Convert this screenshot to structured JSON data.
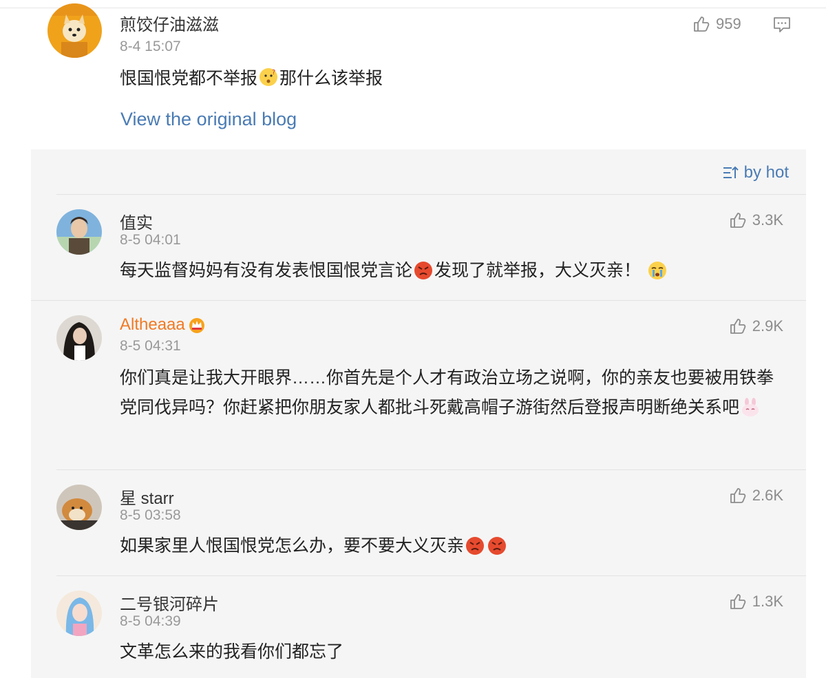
{
  "post": {
    "author": "煎饺仔油滋滋",
    "time": "8-4 15:07",
    "text_before": "恨国恨党都不举报",
    "text_after": "那什么该举报",
    "likes": "959",
    "view_original": "View the original blog"
  },
  "sort_label": "by hot",
  "comments": [
    {
      "author": "值实",
      "time": "8-5 04:01",
      "likes": "3.3K",
      "text_a": "每天监督妈妈有没有发表恨国恨党言论",
      "text_b": "发现了就举报，大义灭亲！"
    },
    {
      "author": "Altheaaa",
      "time": "8-5 04:31",
      "likes": "2.9K",
      "text": "你们真是让我大开眼界……你首先是个人才有政治立场之说啊，你的亲友也要被用铁拳党同伐异吗？你赶紧把你朋友家人都批斗死戴高帽子游街然后登报声明断绝关系吧"
    },
    {
      "author": "星 starr",
      "time": "8-5 03:58",
      "likes": "2.6K",
      "text": "如果家里人恨国恨党怎么办，要不要大义灭亲"
    },
    {
      "author": "二号银河碎片",
      "time": "8-5 04:39",
      "likes": "1.3K",
      "text": "文革怎么来的我看你们都忘了"
    }
  ],
  "colors": {
    "link": "#4a7bb4",
    "vip_name": "#f07a24",
    "muted": "#999999",
    "panel_bg": "#f5f5f5"
  },
  "icons": [
    "like-icon",
    "comment-icon",
    "sort-icon",
    "thinking-emoji",
    "angry-emoji",
    "crying-emoji",
    "crown-icon",
    "bunny-emoji"
  ]
}
